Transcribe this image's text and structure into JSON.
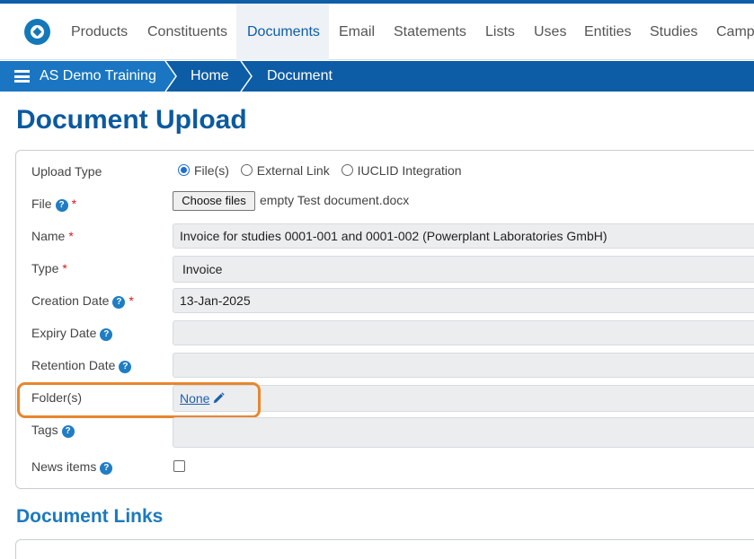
{
  "nav": {
    "items": [
      {
        "label": "Products"
      },
      {
        "label": "Constituents"
      },
      {
        "label": "Documents"
      },
      {
        "label": "Email"
      },
      {
        "label": "Statements"
      },
      {
        "label": "Lists"
      },
      {
        "label": "Uses"
      },
      {
        "label": "Entities"
      },
      {
        "label": "Studies"
      },
      {
        "label": "Camp"
      }
    ],
    "active": "Documents"
  },
  "breadcrumb": [
    "AS Demo Training",
    "Home",
    "Document"
  ],
  "page_title": "Document Upload",
  "form": {
    "upload_type": {
      "label": "Upload Type",
      "options": [
        "File(s)",
        "External Link",
        "IUCLID Integration"
      ],
      "selected": "File(s)"
    },
    "file": {
      "label": "File",
      "button": "Choose files",
      "filename": "empty Test document.docx"
    },
    "name": {
      "label": "Name",
      "value": "Invoice for studies 0001-001 and 0001-002 (Powerplant Laboratories GmbH)"
    },
    "type": {
      "label": "Type",
      "value": "Invoice"
    },
    "creation_date": {
      "label": "Creation Date",
      "value": "13-Jan-2025"
    },
    "expiry_date": {
      "label": "Expiry Date",
      "value": ""
    },
    "retention_date": {
      "label": "Retention Date",
      "value": ""
    },
    "folders": {
      "label": "Folder(s)",
      "value": "None"
    },
    "tags": {
      "label": "Tags",
      "value": ""
    },
    "news_items": {
      "label": "News items",
      "checked": false
    }
  },
  "required_marker": "*",
  "help_marker": "?",
  "section2_title": "Document Links",
  "colors": {
    "primary": "#0c5a9e",
    "breadcrumb": "#0d5ca6",
    "breadcrumb_first": "#1a76c2",
    "highlight": "#e8862e",
    "required": "#d21c1c"
  }
}
